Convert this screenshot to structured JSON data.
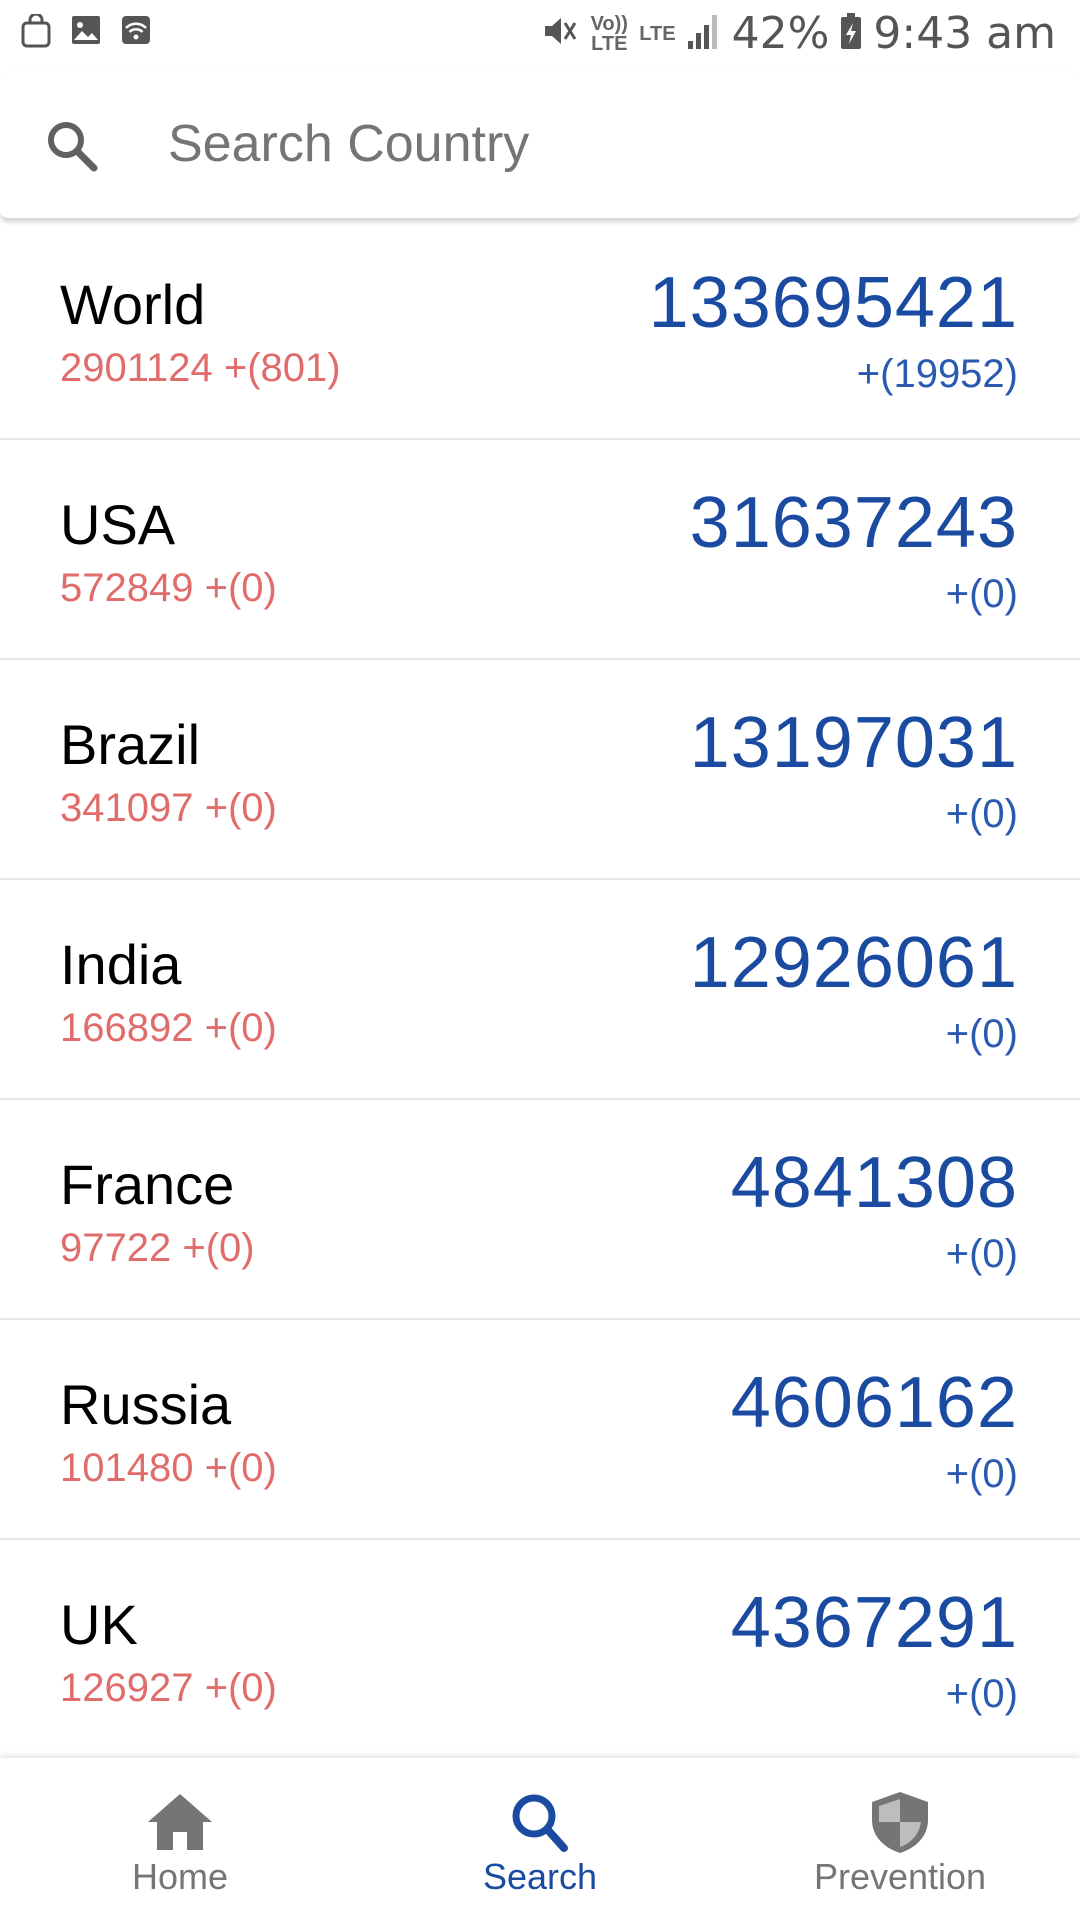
{
  "status_bar": {
    "volte_label": "Vo)) LTE",
    "lte_label": "LTE",
    "battery": "42%",
    "time": "9:43 am",
    "icons": [
      "shopping-bag-icon",
      "image-icon",
      "wifi-box-icon",
      "mute-icon",
      "signal-icon",
      "battery-charging-icon"
    ]
  },
  "search": {
    "placeholder": "Search Country",
    "value": ""
  },
  "countries": [
    {
      "name": "World",
      "deaths": "2901124 +(801)",
      "total": "133695421",
      "new": "+(19952)"
    },
    {
      "name": "USA",
      "deaths": "572849 +(0)",
      "total": "31637243",
      "new": "+(0)"
    },
    {
      "name": "Brazil",
      "deaths": "341097 +(0)",
      "total": "13197031",
      "new": "+(0)"
    },
    {
      "name": "India",
      "deaths": "166892 +(0)",
      "total": "12926061",
      "new": "+(0)"
    },
    {
      "name": "France",
      "deaths": "97722 +(0)",
      "total": "4841308",
      "new": "+(0)"
    },
    {
      "name": "Russia",
      "deaths": "101480 +(0)",
      "total": "4606162",
      "new": "+(0)"
    },
    {
      "name": "UK",
      "deaths": "126927 +(0)",
      "total": "4367291",
      "new": "+(0)"
    }
  ],
  "bottom_nav": {
    "active": "Search",
    "items": [
      {
        "label": "Home",
        "icon": "home-icon"
      },
      {
        "label": "Search",
        "icon": "search-icon"
      },
      {
        "label": "Prevention",
        "icon": "shield-icon"
      }
    ]
  },
  "colors": {
    "accent": "#1a4ba0",
    "deaths": "#e06c6c",
    "inactive": "#757575"
  }
}
